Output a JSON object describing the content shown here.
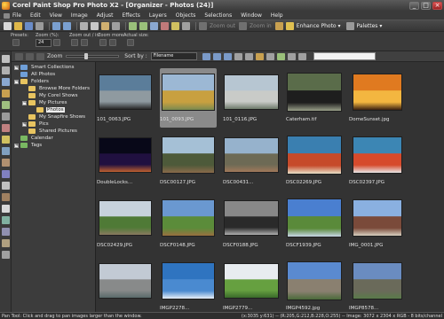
{
  "window": {
    "title": "Corel Paint Shop Pro Photo X2 - [Organizer - Photos (24)]",
    "minimize": "_",
    "maximize": "□",
    "close": "×"
  },
  "menu": [
    "File",
    "Edit",
    "View",
    "Image",
    "Adjust",
    "Effects",
    "Layers",
    "Objects",
    "Selections",
    "Window",
    "Help"
  ],
  "toolbar": {
    "zoom_out": "Zoom out",
    "zoom_in": "Zoom in",
    "enhance_photo": "Enhance Photo ▾",
    "palettes": "Palettes ▾"
  },
  "tool_options": {
    "presets": "Presets:",
    "zoom_pct": "Zoom (%):",
    "zoom_value": "24",
    "zoom_out_in": "Zoom out / in:",
    "zoom_more": "Zoom more:",
    "actual_size": "Actual size:"
  },
  "panel": {
    "zoom_label": "Zoom",
    "sort_label": "Sort by :",
    "sort_value": "Filename",
    "zoom_level": 0.35
  },
  "nav_tree": [
    {
      "label": "Smart Collections",
      "expander": "+",
      "indent": 0,
      "icon": "folder-blue",
      "selected": false
    },
    {
      "label": "All Photos",
      "expander": "",
      "indent": 0,
      "icon": "folder-blue",
      "selected": false
    },
    {
      "label": "Folders",
      "expander": "−",
      "indent": 0,
      "icon": "folder",
      "selected": false
    },
    {
      "label": "Browse More Folders",
      "expander": "",
      "indent": 1,
      "icon": "folder",
      "selected": false
    },
    {
      "label": "My Corel Shows",
      "expander": "",
      "indent": 1,
      "icon": "folder",
      "selected": false
    },
    {
      "label": "My Pictures",
      "expander": "−",
      "indent": 1,
      "icon": "folder",
      "selected": false
    },
    {
      "label": "Photos",
      "expander": "",
      "indent": 2,
      "icon": "folder",
      "selected": true
    },
    {
      "label": "My Snapfire Shows",
      "expander": "",
      "indent": 1,
      "icon": "folder",
      "selected": false
    },
    {
      "label": "Pics",
      "expander": "+",
      "indent": 1,
      "icon": "folder",
      "selected": false
    },
    {
      "label": "Shared Pictures",
      "expander": "",
      "indent": 1,
      "icon": "folder",
      "selected": false
    },
    {
      "label": "Calendar",
      "expander": "",
      "indent": 0,
      "icon": "folder-green",
      "selected": false
    },
    {
      "label": "Tags",
      "expander": "+",
      "indent": 0,
      "icon": "folder-green",
      "selected": false
    }
  ],
  "thumbnails": [
    {
      "name": "101_0063.JPG",
      "selected": false,
      "colors": [
        "#5b7d9a",
        "#8f9aa0",
        "#2a2a2a"
      ]
    },
    {
      "name": "101_0093.JPG",
      "selected": true,
      "colors": [
        "#9cb8d4",
        "#c8a040",
        "#7a8a50"
      ]
    },
    {
      "name": "101_0116.JPG",
      "selected": false,
      "colors": [
        "#b7c6d2",
        "#c9cbc8",
        "#6d7a6a"
      ]
    },
    {
      "name": "Caterham.tif",
      "selected": false,
      "colors": [
        "#5a6c4a",
        "#1e1e1e",
        "#9aa08a"
      ]
    },
    {
      "name": "DomeSunset.jpg",
      "selected": false,
      "colors": [
        "#e07a20",
        "#f3b640",
        "#3a2010"
      ]
    },
    {
      "name": "DoubleLocks...",
      "selected": false,
      "colors": [
        "#080818",
        "#201040",
        "#c06030"
      ]
    },
    {
      "name": "DSC00127.JPG",
      "selected": false,
      "colors": [
        "#a5c0d6",
        "#4d5a3a",
        "#8a6a4a"
      ]
    },
    {
      "name": "DSC00431...",
      "selected": false,
      "colors": [
        "#96b2cc",
        "#6d6a55",
        "#a0785a"
      ]
    },
    {
      "name": "DSC02269.JPG",
      "selected": false,
      "colors": [
        "#3a7fb0",
        "#c64a2a",
        "#e8e0c8"
      ]
    },
    {
      "name": "DSC02397.JPG",
      "selected": false,
      "colors": [
        "#3c86b4",
        "#d64a2c",
        "#e8e8e8"
      ]
    },
    {
      "name": "DSC02429.JPG",
      "selected": false,
      "colors": [
        "#c7d2dc",
        "#4f7a36",
        "#8a7a60"
      ]
    },
    {
      "name": "DSCF0148.JPG",
      "selected": false,
      "colors": [
        "#6a98d0",
        "#5b8c3a",
        "#9a7040"
      ]
    },
    {
      "name": "DSCF0188.JPG",
      "selected": false,
      "colors": [
        "#888888",
        "#2a2a2a",
        "#b0b0b0"
      ]
    },
    {
      "name": "DSCF1939.JPG",
      "selected": false,
      "colors": [
        "#4a7fd0",
        "#5a8a3a",
        "#c8d6e8"
      ]
    },
    {
      "name": "IMG_0001.JPG",
      "selected": false,
      "colors": [
        "#8ab0e0",
        "#7a4a3a",
        "#d8d0c0"
      ]
    },
    {
      "name": "",
      "selected": false,
      "colors": [
        "#c2cad4",
        "#888a8a",
        "#5a6a6a"
      ]
    },
    {
      "name": "IMGP2278...",
      "selected": false,
      "colors": [
        "#2f74c0",
        "#4a8ad0",
        "#e8f0f8"
      ]
    },
    {
      "name": "IMGP2779...",
      "selected": false,
      "colors": [
        "#e8ecf0",
        "#66a040",
        "#3a6a2a"
      ]
    },
    {
      "name": "IMGP4592.jpg",
      "selected": false,
      "colors": [
        "#5a8ad0",
        "#8a8070",
        "#4a6a3a"
      ]
    },
    {
      "name": "IMGP8578...",
      "selected": false,
      "colors": [
        "#6a8cc0",
        "#6a6a5a",
        "#5a7a4a"
      ]
    }
  ],
  "statusbar": {
    "left": "Pan Tool: Click and drag to pan images larger than the window.",
    "right": "(x:3035 y:631) -- (R:205,G:212,B:228,O:255) -- Image: 3072 x 2304 x RGB - 8 bits/channel"
  },
  "colors": {
    "background": "#3c3c3c",
    "grid_background": "#333333",
    "selected_thumb": "#8a8a8a"
  }
}
